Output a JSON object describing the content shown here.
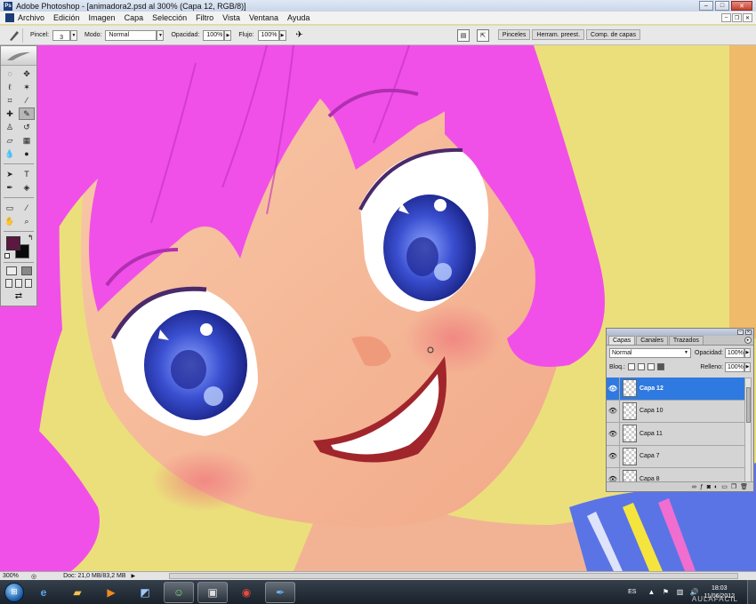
{
  "window": {
    "title": "Adobe Photoshop - [animadora2.psd al 300% (Capa 12, RGB/8)]",
    "controls": [
      "minimize-icon",
      "maximize-icon",
      "close-icon"
    ]
  },
  "menu": {
    "items": [
      "Archivo",
      "Edición",
      "Imagen",
      "Capa",
      "Selección",
      "Filtro",
      "Vista",
      "Ventana",
      "Ayuda"
    ]
  },
  "options_bar": {
    "brush_label": "Pincel:",
    "brush_size": "3",
    "mode_label": "Modo:",
    "mode_value": "Normal",
    "opacity_label": "Opacidad:",
    "opacity_value": "100%",
    "flow_label": "Flujo:",
    "flow_value": "100%",
    "well_tabs": [
      "Pinceles",
      "Herram. preest.",
      "Comp. de capas"
    ]
  },
  "toolbox": {
    "foreground_color": "#5b1840",
    "background_color": "#0a0a0a"
  },
  "layers_panel": {
    "tabs": [
      "Capas",
      "Canales",
      "Trazados"
    ],
    "blend_mode": "Normal",
    "opacity_label": "Opacidad:",
    "opacity_value": "100%",
    "lock_label": "Bloq.:",
    "fill_label": "Relleno:",
    "fill_value": "100%",
    "layers": [
      {
        "name": "Capa 12",
        "visible": true,
        "selected": true
      },
      {
        "name": "Capa 10",
        "visible": true,
        "selected": false
      },
      {
        "name": "Capa 11",
        "visible": true,
        "selected": false
      },
      {
        "name": "Capa 7",
        "visible": true,
        "selected": false
      },
      {
        "name": "Capa 8",
        "visible": true,
        "selected": false
      }
    ]
  },
  "status_bar": {
    "zoom": "300%",
    "doc_info": "Doc: 21,0 MB/83,2 MB"
  },
  "taskbar": {
    "apps": [
      "internet-explorer-icon",
      "explorer-folder-icon",
      "media-player-icon",
      "photo-app-icon",
      "messenger-icon",
      "video-app-icon",
      "chrome-icon",
      "photoshop-icon"
    ],
    "language": "ES",
    "time": "18:03",
    "date": "11/06/2012",
    "watermark": "AULAFACIL"
  }
}
